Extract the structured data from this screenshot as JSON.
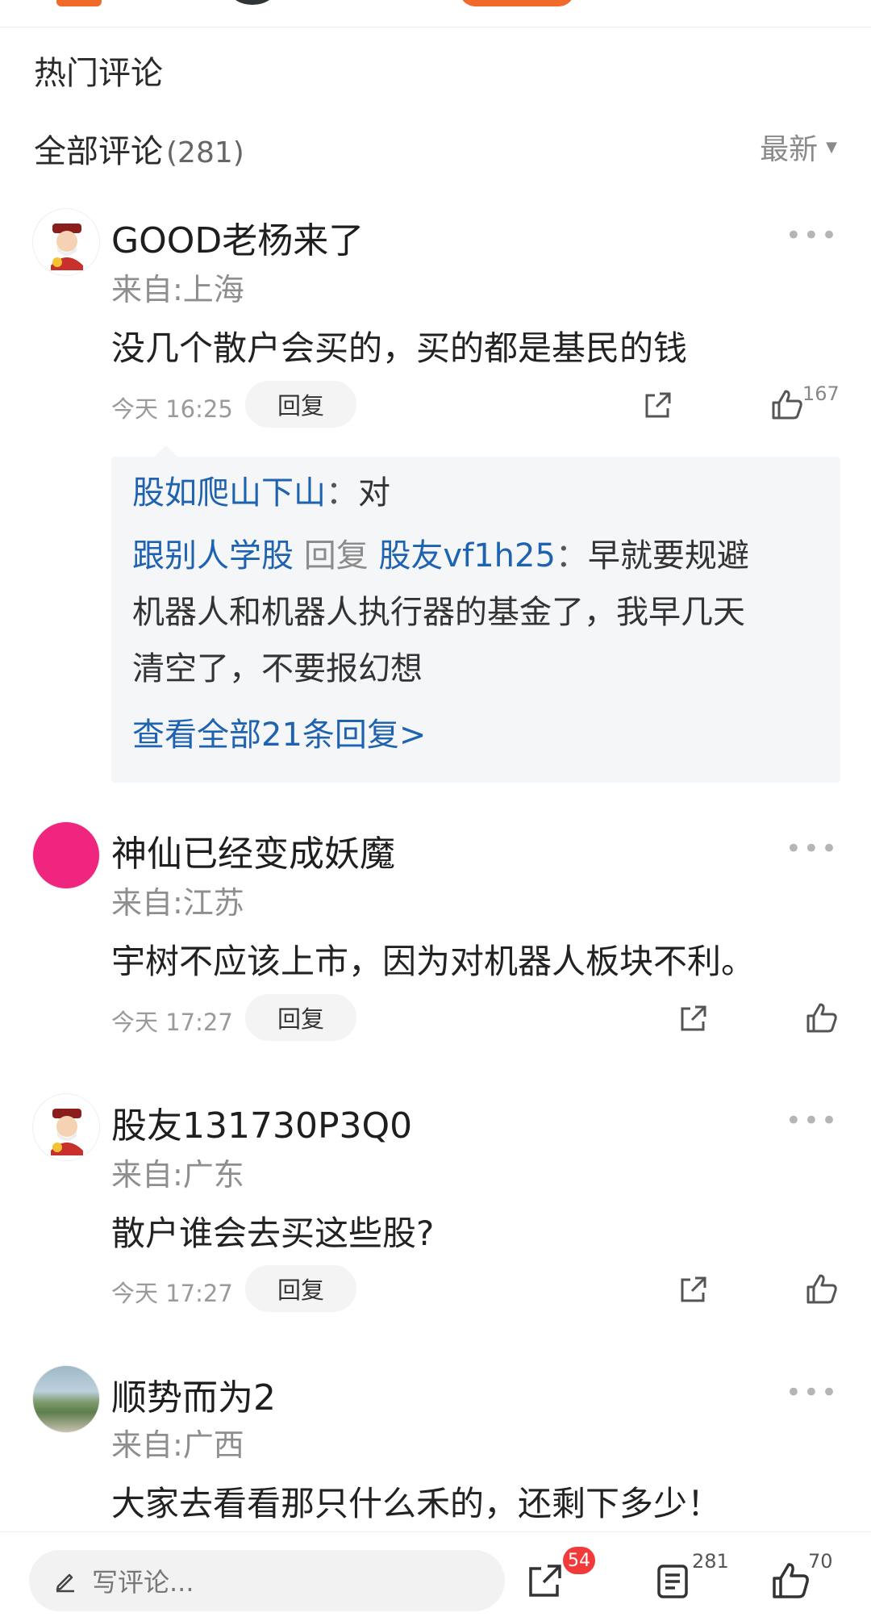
{
  "sections": {
    "hot_title": "热门评论",
    "all_title": "全部评论",
    "all_count": "(281)",
    "sort_label": "最新"
  },
  "comments": [
    {
      "username": "GOOD老杨来了",
      "location": "来自:上海",
      "text": "没几个散户会买的，买的都是基民的钱",
      "time": "今天 16:25",
      "reply_label": "回复",
      "like_count": "167",
      "avatar": "god-of-wealth-avatar"
    },
    {
      "username": "神仙已经变成妖魔",
      "location": "来自:江苏",
      "text": "宇树不应该上市，因为对机器人板块不利。",
      "time": "今天 17:27",
      "reply_label": "回复",
      "like_count": "",
      "avatar": "pink-avatar"
    },
    {
      "username": "股友131730P3Q0",
      "location": "来自:广东",
      "text": "散户谁会去买这些股?",
      "time": "今天 17:27",
      "reply_label": "回复",
      "like_count": "",
      "avatar": "god-of-wealth-avatar"
    },
    {
      "username": "顺势而为2",
      "location": "来自:广西",
      "text": "大家去看看那只什么禾的，还剩下多少！",
      "avatar": "landscape-photo-avatar"
    }
  ],
  "replies": {
    "r1_name": "股如爬山下山",
    "r1_sep": "：",
    "r1_text": "对",
    "r2_name": "跟别人学股",
    "r2_mid": "回复",
    "r2_target": "股友vf1h25",
    "r2_sep": "：",
    "r2_text_l1": "早就要规避",
    "r2_text_l2": "机器人和机器人执行器的基金了，我早几天",
    "r2_text_l3": "清空了，不要报幻想",
    "view_all": "查看全部21条回复>"
  },
  "bottom_bar": {
    "write_placeholder": "写评论...",
    "share_badge": "54",
    "comment_count": "281",
    "like_count": "70"
  },
  "colors": {
    "link_blue": "#1f63b0",
    "badge_red": "#f23a3a",
    "brand_orange": "#f26a2a"
  }
}
